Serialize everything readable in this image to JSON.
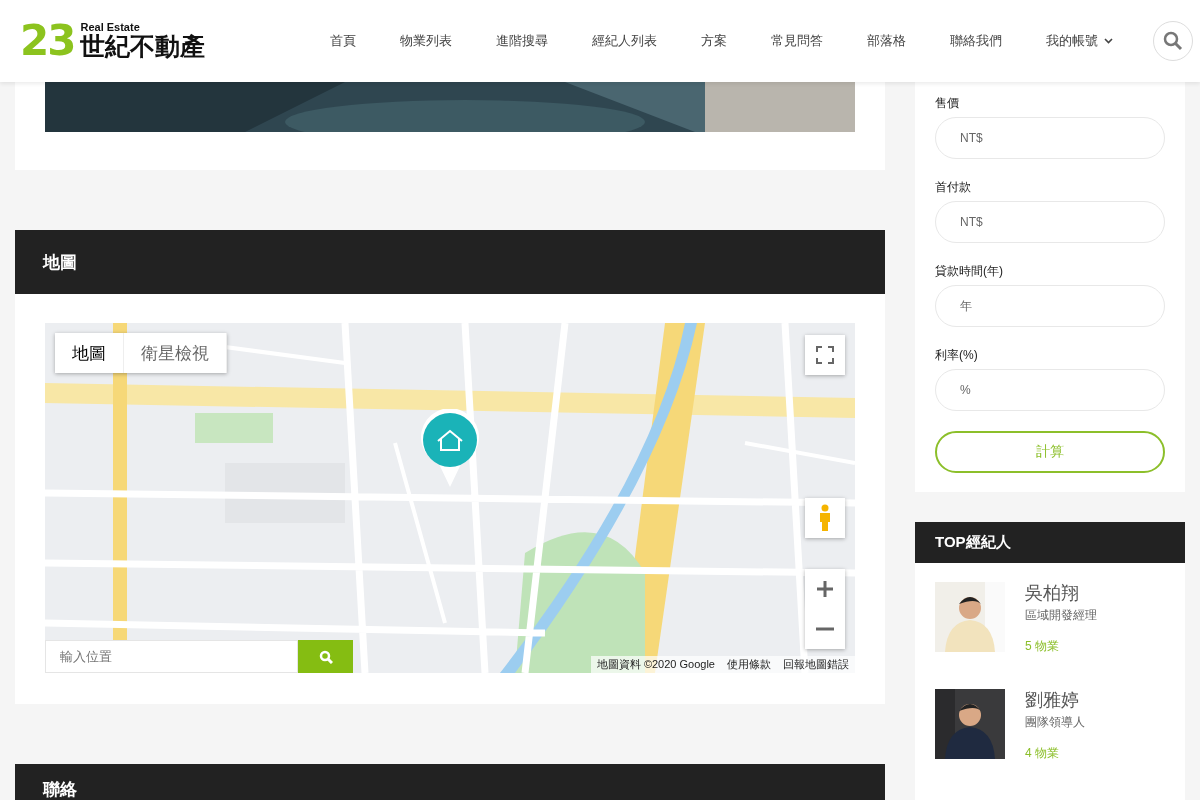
{
  "header": {
    "logo": {
      "number": "23",
      "tagline": "Real Estate",
      "name": "世紀不動產"
    },
    "nav": [
      {
        "label": "首頁",
        "dropdown": false
      },
      {
        "label": "物業列表",
        "dropdown": false
      },
      {
        "label": "進階搜尋",
        "dropdown": false
      },
      {
        "label": "經紀人列表",
        "dropdown": false
      },
      {
        "label": "方案",
        "dropdown": false
      },
      {
        "label": "常見問答",
        "dropdown": false
      },
      {
        "label": "部落格",
        "dropdown": false
      },
      {
        "label": "聯絡我們",
        "dropdown": false
      },
      {
        "label": "我的帳號",
        "dropdown": true
      }
    ]
  },
  "map_section": {
    "title": "地圖",
    "map": {
      "types": [
        {
          "label": "地圖",
          "selected": true
        },
        {
          "label": "衛星檢視",
          "selected": false
        }
      ],
      "search": {
        "placeholder": "輸入位置"
      },
      "attribution": [
        "地圖資料 ©2020 Google",
        "使用條款",
        "回報地圖錯誤"
      ]
    }
  },
  "contact_section": {
    "title": "聯絡"
  },
  "calculator": {
    "fields": [
      {
        "label": "售價",
        "placeholder": "NT$"
      },
      {
        "label": "首付款",
        "placeholder": "NT$"
      },
      {
        "label": "貸款時間(年)",
        "placeholder": "年"
      },
      {
        "label": "利率(%)",
        "placeholder": "%"
      }
    ],
    "button": "計算"
  },
  "top_agents": {
    "title": "TOP經紀人",
    "agents": [
      {
        "name": "吳柏翔",
        "role": "區域開發經理",
        "listings": "5 物業"
      },
      {
        "name": "劉雅婷",
        "role": "團隊領導人",
        "listings": "4 物業"
      }
    ]
  }
}
